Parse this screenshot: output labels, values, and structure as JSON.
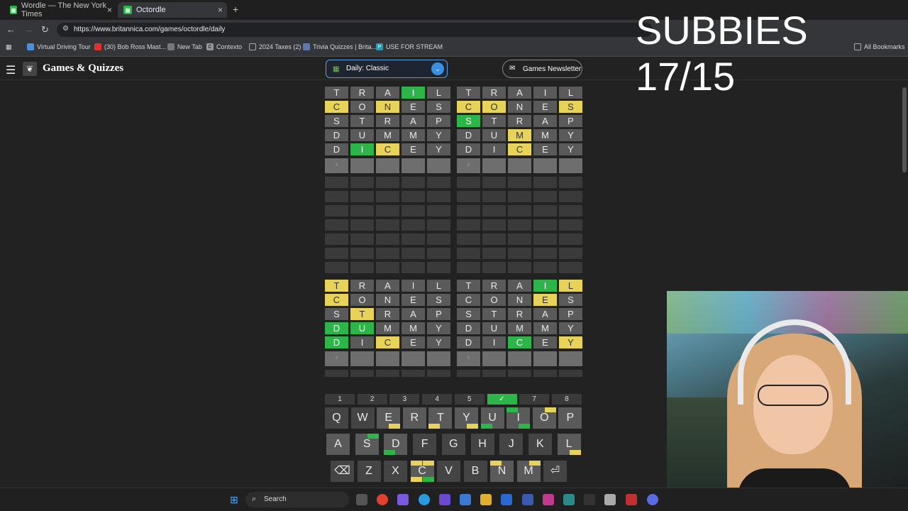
{
  "browser": {
    "tabs": [
      {
        "title": "Wordle — The New York Times",
        "icon": "nyt-wordle-icon"
      },
      {
        "title": "Octordle",
        "icon": "octordle-icon"
      }
    ],
    "url": "https://www.britannica.com/games/octordle/daily",
    "bookmarks": [
      "Virtual Driving Tour",
      "(30) Bob Ross Mast...",
      "New Tab",
      "Contexto",
      "2024 Taxes (2)",
      "Trivia Quizzes | Brita...",
      "USE FOR STREAM"
    ],
    "all_bookmarks": "All Bookmarks"
  },
  "site": {
    "brand": "Games & Quizzes",
    "mode": "Daily: Classic",
    "newsletter": "Games Newsletter"
  },
  "overlay": {
    "subbies": "SUBBIES 17/15"
  },
  "game": {
    "guesses": [
      "TRAIL",
      "CONES",
      "STRAP",
      "DUMMY",
      "DICEY"
    ],
    "current_row_number": "8",
    "colors": {
      "absent": "#5a5a5a",
      "present": "#e8d35a",
      "correct": "#2eb54a"
    },
    "boards": [
      {
        "states": [
          "00020",
          "10100",
          "00000",
          "00000",
          "02100"
        ]
      },
      {
        "states": [
          "00000",
          "11001",
          "20000",
          "00100",
          "00100"
        ]
      },
      {
        "states": [
          "10000",
          "10000",
          "01000",
          "22000",
          "20100"
        ]
      },
      {
        "states": [
          "00021",
          "00010",
          "00000",
          "00000",
          "00201"
        ]
      }
    ],
    "board_tabs": [
      "1",
      "2",
      "3",
      "4",
      "5",
      "✓",
      "7",
      "8"
    ],
    "solved_board": 6,
    "keyboard": {
      "row1": [
        "Q",
        "W",
        "E",
        "R",
        "T",
        "Y",
        "U",
        "I",
        "O",
        "P"
      ],
      "row2": [
        "A",
        "S",
        "D",
        "F",
        "G",
        "H",
        "J",
        "K",
        "L"
      ],
      "row3": [
        "⌫",
        "Z",
        "X",
        "C",
        "V",
        "B",
        "N",
        "M",
        "⏎"
      ]
    }
  },
  "taskbar": {
    "search": "Search"
  }
}
